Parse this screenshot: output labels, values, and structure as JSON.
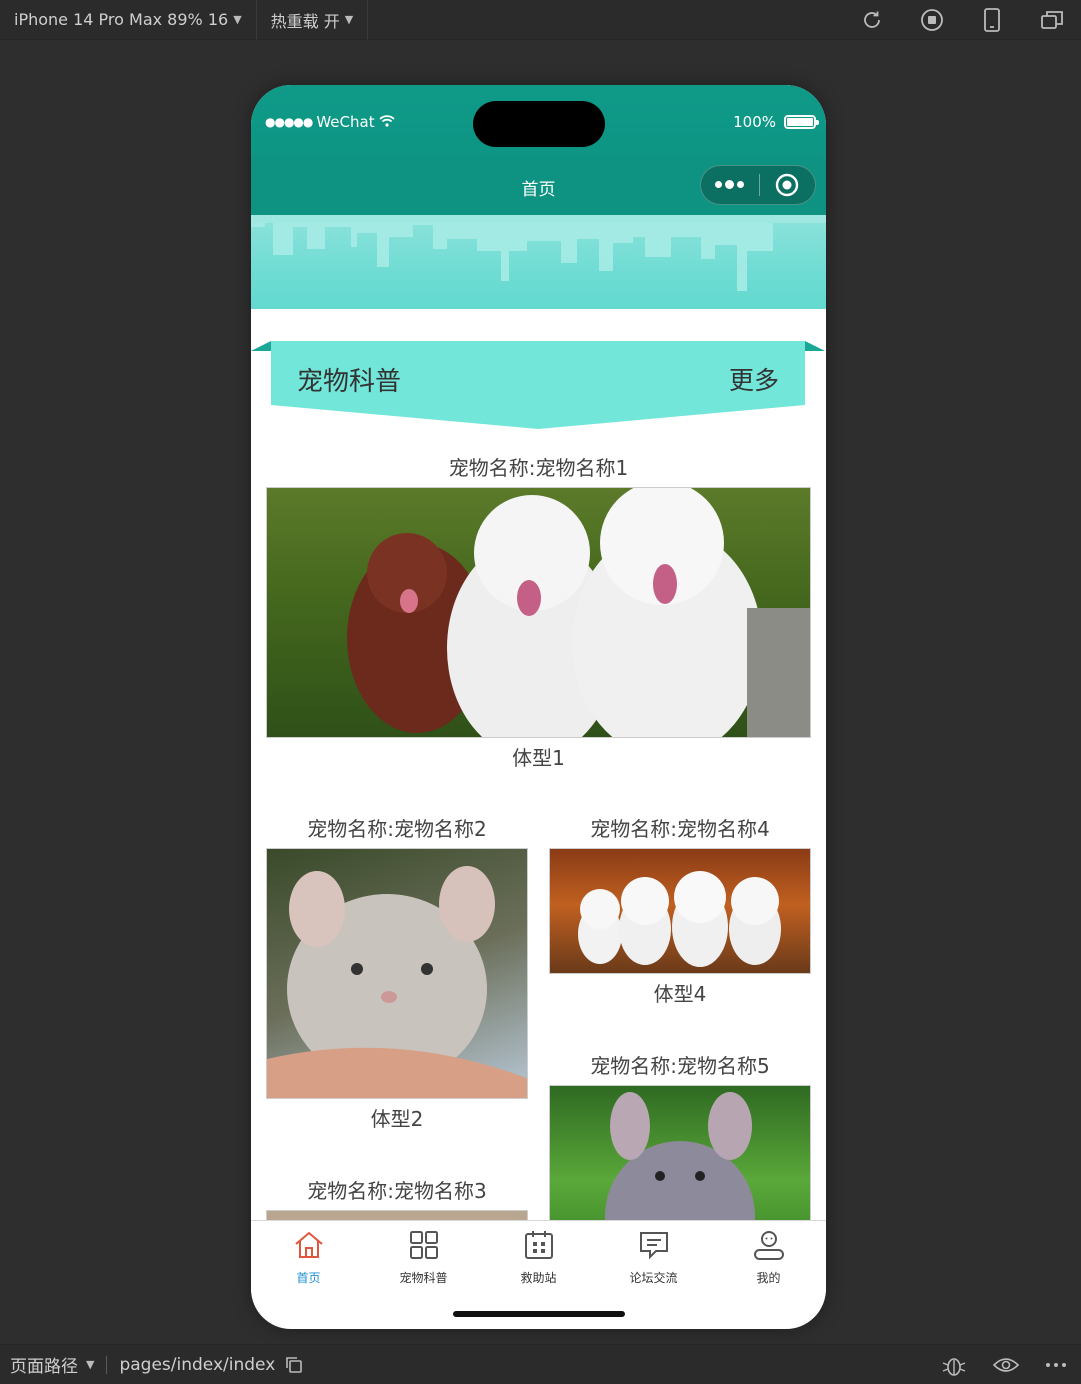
{
  "ide": {
    "device_selector": "iPhone 14 Pro Max 89% 16",
    "hot_reload": "热重载 开",
    "path_label": "页面路径",
    "path_value": "pages/index/index"
  },
  "status_bar": {
    "carrier": "WeChat",
    "signal_dots": "●●●●●",
    "battery": "100%"
  },
  "nav": {
    "title": "首页"
  },
  "section": {
    "title": "宠物科普",
    "more": "更多"
  },
  "pets": [
    {
      "name": "宠物名称:宠物名称1",
      "type": "体型1"
    },
    {
      "name": "宠物名称:宠物名称2",
      "type": "体型2"
    },
    {
      "name": "宠物名称:宠物名称3",
      "type": ""
    },
    {
      "name": "宠物名称:宠物名称4",
      "type": "体型4"
    },
    {
      "name": "宠物名称:宠物名称5",
      "type": ""
    }
  ],
  "tabs": [
    {
      "label": "首页",
      "icon": "home-icon",
      "active": true
    },
    {
      "label": "宠物科普",
      "icon": "grid-icon",
      "active": false
    },
    {
      "label": "救助站",
      "icon": "calendar-icon",
      "active": false
    },
    {
      "label": "论坛交流",
      "icon": "message-icon",
      "active": false
    },
    {
      "label": "我的",
      "icon": "user-icon",
      "active": false
    }
  ],
  "colors": {
    "nav_bg": "#0e9382",
    "banner": "#6fdcd3",
    "ribbon": "#72e6d8",
    "tab_active": "#1e8fd6",
    "tab_active_icon": "#e2553d"
  }
}
